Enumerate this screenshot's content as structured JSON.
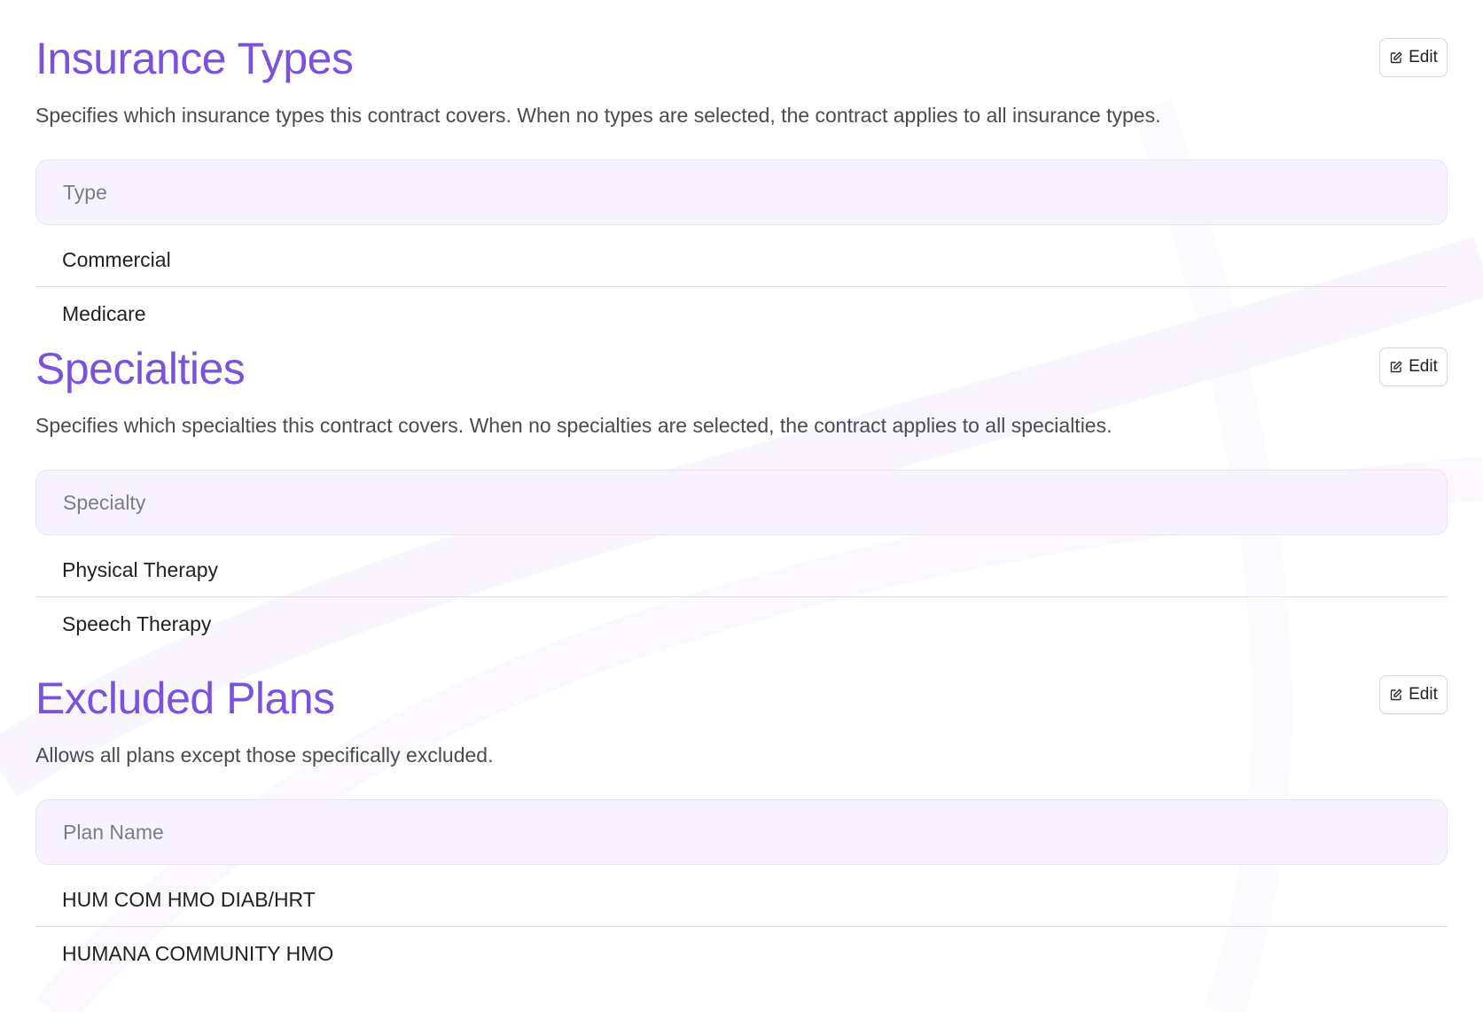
{
  "sections": [
    {
      "title": "Insurance Types",
      "edit_label": "Edit",
      "description": "Specifies which insurance types this contract covers. When no types are selected, the contract applies to all insurance types.",
      "column_header": "Type",
      "rows": [
        "Commercial",
        "Medicare"
      ]
    },
    {
      "title": "Specialties",
      "edit_label": "Edit",
      "description": "Specifies which specialties this contract covers. When no specialties are selected, the contract applies to all specialties.",
      "column_header": "Specialty",
      "rows": [
        "Physical Therapy",
        "Speech Therapy"
      ]
    },
    {
      "title": "Excluded Plans",
      "edit_label": "Edit",
      "description": "Allows all plans except those specifically excluded.",
      "column_header": "Plan Name",
      "rows": [
        "HUM COM HMO DIAB/HRT",
        "HUMANA COMMUNITY HMO"
      ]
    }
  ],
  "icons": {
    "edit": "edit-pencil-icon"
  },
  "colors": {
    "title": "#7a52dc",
    "header_bg": "#f7f3fe",
    "divider": "#dcdce2"
  }
}
